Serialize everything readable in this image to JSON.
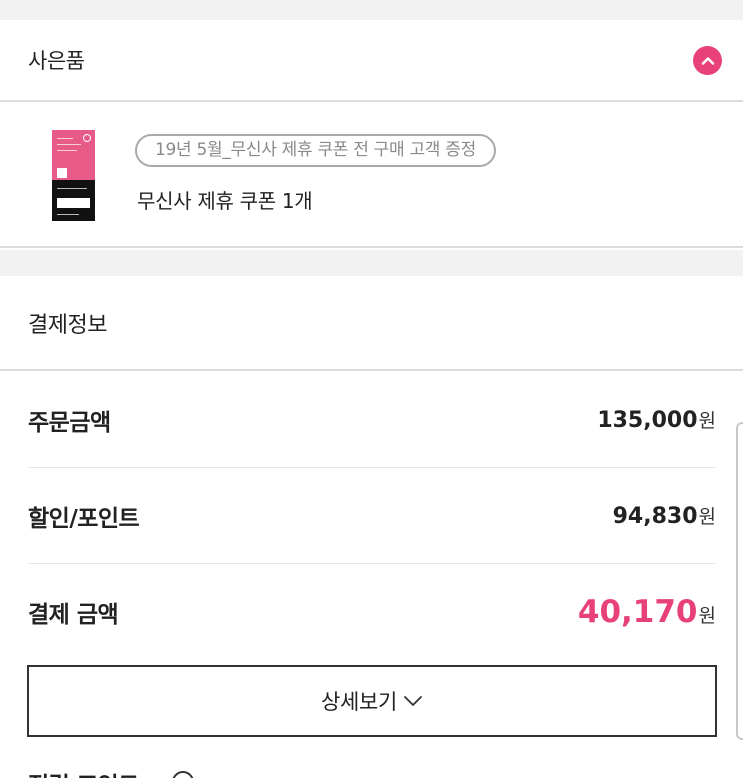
{
  "gift": {
    "title": "사은품",
    "tag": "19년 5월_무신사 제휴 쿠폰 전 구매 고객 증정",
    "item_name": "무신사 제휴 쿠폰 1개"
  },
  "payment": {
    "title": "결제정보",
    "rows": [
      {
        "label": "주문금액",
        "amount": "135,000",
        "unit": "원"
      },
      {
        "label": "할인/포인트",
        "amount": "94,830",
        "unit": "원"
      },
      {
        "label": "결제 금액",
        "amount": "40,170",
        "unit": "원"
      }
    ],
    "detail_button": "상세보기",
    "next_section_title": "적립 포인트"
  },
  "colors": {
    "accent": "#e8417a",
    "divider": "#dcdcdc",
    "background": "#f2f2f2"
  },
  "icons": {
    "collapse": "chevron-up-icon",
    "detail": "chevron-down-icon",
    "info": "info-icon"
  }
}
